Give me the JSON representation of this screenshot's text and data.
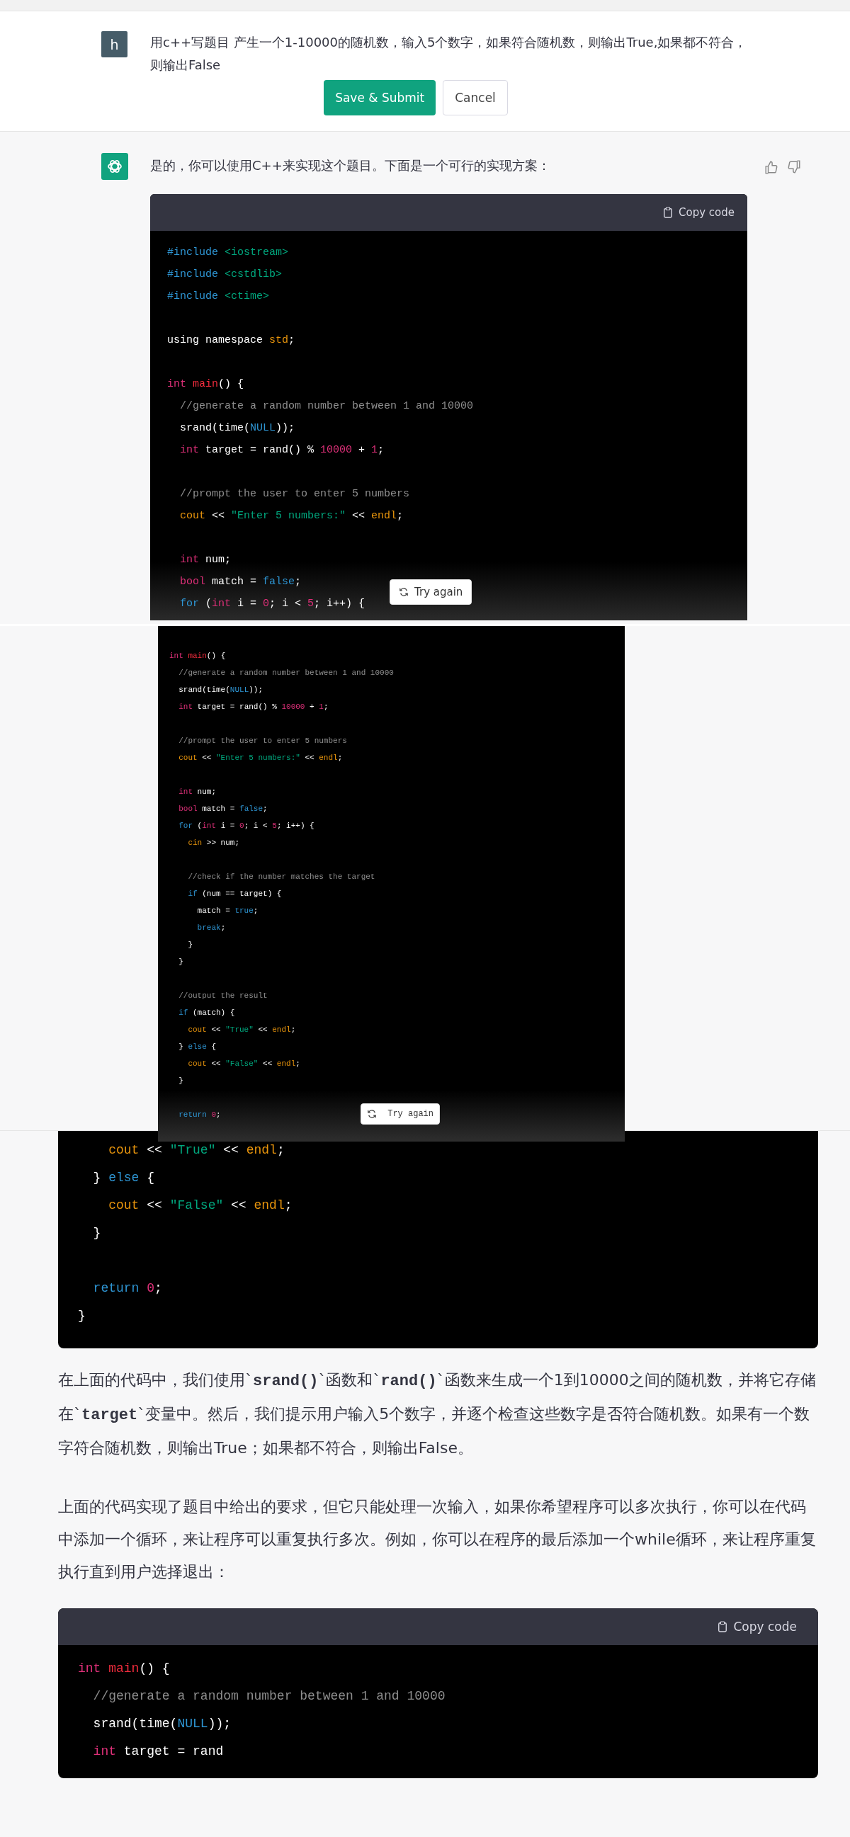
{
  "edit_view": {
    "user_message": {
      "avatar": "h",
      "text": "用c++写题目 产生一个1-10000的随机数，输入5个数字，如果符合随机数，则输出True,如果都不符合，则输出False"
    },
    "buttons": [
      {
        "label": "Save & Submit",
        "kind": "primary"
      },
      {
        "label": "Cancel",
        "kind": "secondary"
      }
    ],
    "assistant": {
      "intro": "是的，你可以使用C++来实现这个题目。下面是一个可行的实现方案：",
      "code_block": {
        "copy_label": "Copy code",
        "lines": [
          {
            "segments": [
              {
                "t": "#include",
                "kind": "meta"
              },
              {
                "t": " <iostream>",
                "kind": "meta_string"
              }
            ]
          },
          {
            "segments": [
              {
                "t": "#include",
                "kind": "meta"
              },
              {
                "t": " <cstdlib>",
                "kind": "meta_string"
              }
            ]
          },
          {
            "segments": [
              {
                "t": "#include",
                "kind": "meta"
              },
              {
                "t": " <ctime>",
                "kind": "meta_string"
              }
            ]
          },
          {
            "gap_before": true,
            "segments": [
              {
                "t": "using namespace"
              },
              {
                "t": " std",
                "kind": "builtin"
              },
              {
                "t": ";"
              }
            ]
          },
          {
            "gap_before": true,
            "segments": [
              {
                "t": "int",
                "kind": "type"
              },
              {
                "t": " main",
                "kind": "title"
              },
              {
                "t": "() {"
              }
            ]
          },
          {
            "segments": [
              {
                "t": "  //generate a random number between 1 and 10000",
                "kind": "comment"
              }
            ]
          },
          {
            "segments": [
              {
                "t": "  srand(time("
              },
              {
                "t": "NULL",
                "kind": "keyword"
              },
              {
                "t": "));"
              }
            ]
          },
          {
            "segments": [
              {
                "t": "  int",
                "kind": "type"
              },
              {
                "t": " target = rand() % "
              },
              {
                "t": "10000",
                "kind": "number"
              },
              {
                "t": " + "
              },
              {
                "t": "1",
                "kind": "number"
              },
              {
                "t": ";"
              }
            ]
          },
          {
            "gap_before": true,
            "segments": [
              {
                "t": "  //prompt the user to enter 5 numbers",
                "kind": "comment"
              }
            ]
          },
          {
            "segments": [
              {
                "t": "  cout",
                "kind": "builtin"
              },
              {
                "t": " << "
              },
              {
                "t": "\"Enter 5 numbers:\"",
                "kind": "string"
              },
              {
                "t": " << "
              },
              {
                "t": "endl",
                "kind": "builtin"
              },
              {
                "t": ";"
              }
            ]
          },
          {
            "gap_before": true,
            "segments": [
              {
                "t": "  int",
                "kind": "type"
              },
              {
                "t": " num;"
              }
            ]
          },
          {
            "segments": [
              {
                "t": "  bool",
                "kind": "type"
              },
              {
                "t": " match = "
              },
              {
                "t": "false",
                "kind": "keyword"
              },
              {
                "t": ";"
              }
            ]
          },
          {
            "segments": [
              {
                "t": "  for",
                "kind": "keyword"
              },
              {
                "t": " ("
              },
              {
                "t": "int",
                "kind": "type"
              },
              {
                "t": " i = "
              },
              {
                "t": "0",
                "kind": "number"
              },
              {
                "t": "; i < "
              },
              {
                "t": "5",
                "kind": "number"
              },
              {
                "t": "; i++) {"
              }
            ]
          }
        ]
      },
      "try_again": "Try again"
    }
  },
  "code_snapshot": {
    "lines": [
      {
        "segments": [
          {
            "t": "int",
            "kind": "type"
          },
          {
            "t": " main",
            "kind": "title"
          },
          {
            "t": "() {"
          }
        ]
      },
      {
        "segments": [
          {
            "t": "  //generate a random number between 1 and 10000",
            "kind": "comment"
          }
        ]
      },
      {
        "segments": [
          {
            "t": "  srand(time("
          },
          {
            "t": "NULL",
            "kind": "keyword"
          },
          {
            "t": "));"
          }
        ]
      },
      {
        "segments": [
          {
            "t": "  int",
            "kind": "type"
          },
          {
            "t": " target = rand() % "
          },
          {
            "t": "10000",
            "kind": "number"
          },
          {
            "t": " + "
          },
          {
            "t": "1",
            "kind": "number"
          },
          {
            "t": ";"
          }
        ]
      },
      {
        "gap_before": true,
        "segments": [
          {
            "t": "  //prompt the user to enter 5 numbers",
            "kind": "comment"
          }
        ]
      },
      {
        "segments": [
          {
            "t": "  cout",
            "kind": "builtin"
          },
          {
            "t": " << "
          },
          {
            "t": "\"Enter 5 numbers:\"",
            "kind": "string"
          },
          {
            "t": " << "
          },
          {
            "t": "endl",
            "kind": "builtin"
          },
          {
            "t": ";"
          }
        ]
      },
      {
        "gap_before": true,
        "segments": [
          {
            "t": "  int",
            "kind": "type"
          },
          {
            "t": " num;"
          }
        ]
      },
      {
        "segments": [
          {
            "t": "  bool",
            "kind": "type"
          },
          {
            "t": " match = "
          },
          {
            "t": "false",
            "kind": "keyword"
          },
          {
            "t": ";"
          }
        ]
      },
      {
        "segments": [
          {
            "t": "  for",
            "kind": "keyword"
          },
          {
            "t": " ("
          },
          {
            "t": "int",
            "kind": "type"
          },
          {
            "t": " i = "
          },
          {
            "t": "0",
            "kind": "number"
          },
          {
            "t": "; i < "
          },
          {
            "t": "5",
            "kind": "number"
          },
          {
            "t": "; i++) {"
          }
        ]
      },
      {
        "segments": [
          {
            "t": "    cin",
            "kind": "builtin"
          },
          {
            "t": " >> num;"
          }
        ]
      },
      {
        "gap_before": true,
        "segments": [
          {
            "t": "    //check if the number matches the target",
            "kind": "comment"
          }
        ]
      },
      {
        "segments": [
          {
            "t": "    if",
            "kind": "keyword"
          },
          {
            "t": " (num == target) {"
          }
        ]
      },
      {
        "segments": [
          {
            "t": "      match = "
          },
          {
            "t": "true",
            "kind": "keyword"
          },
          {
            "t": ";"
          }
        ]
      },
      {
        "segments": [
          {
            "t": "      break",
            "kind": "keyword"
          },
          {
            "t": ";"
          }
        ]
      },
      {
        "segments": [
          {
            "t": "    }"
          }
        ]
      },
      {
        "segments": [
          {
            "t": "  }"
          }
        ]
      },
      {
        "gap_before": true,
        "segments": [
          {
            "t": "  //output the result",
            "kind": "comment"
          }
        ]
      },
      {
        "segments": [
          {
            "t": "  if",
            "kind": "keyword"
          },
          {
            "t": " (match) {"
          }
        ]
      },
      {
        "segments": [
          {
            "t": "    cout",
            "kind": "builtin"
          },
          {
            "t": " << "
          },
          {
            "t": "\"True\"",
            "kind": "string"
          },
          {
            "t": " << "
          },
          {
            "t": "endl",
            "kind": "builtin"
          },
          {
            "t": ";"
          }
        ]
      },
      {
        "segments": [
          {
            "t": "  }"
          },
          {
            "t": " else",
            "kind": "keyword"
          },
          {
            "t": " {"
          }
        ]
      },
      {
        "segments": [
          {
            "t": "    cout",
            "kind": "builtin"
          },
          {
            "t": " << "
          },
          {
            "t": "\"False\"",
            "kind": "string"
          },
          {
            "t": " << "
          },
          {
            "t": "endl",
            "kind": "builtin"
          },
          {
            "t": ";"
          }
        ]
      },
      {
        "segments": [
          {
            "t": "  }"
          }
        ]
      },
      {
        "gap_before": true,
        "segments": [
          {
            "t": "  return",
            "kind": "keyword"
          },
          {
            "t": " 0",
            "kind": "number"
          },
          {
            "t": ";"
          }
        ]
      }
    ],
    "try_again": "Try again"
  },
  "answer_view": {
    "code_tail": [
      {
        "segments": [
          {
            "t": "    cout",
            "kind": "builtin"
          },
          {
            "t": " << "
          },
          {
            "t": "\"True\"",
            "kind": "string"
          },
          {
            "t": " << "
          },
          {
            "t": "endl",
            "kind": "builtin"
          },
          {
            "t": ";"
          }
        ]
      },
      {
        "segments": [
          {
            "t": "  }"
          },
          {
            "t": " else",
            "kind": "keyword"
          },
          {
            "t": " {"
          }
        ]
      },
      {
        "segments": [
          {
            "t": "    cout",
            "kind": "builtin"
          },
          {
            "t": " << "
          },
          {
            "t": "\"False\"",
            "kind": "string"
          },
          {
            "t": " << "
          },
          {
            "t": "endl",
            "kind": "builtin"
          },
          {
            "t": ";"
          }
        ]
      },
      {
        "segments": [
          {
            "t": "  }"
          }
        ]
      },
      {
        "gap_before": true,
        "segments": [
          {
            "t": "  return",
            "kind": "keyword"
          },
          {
            "t": " 0",
            "kind": "number"
          },
          {
            "t": ";"
          }
        ]
      },
      {
        "segments": [
          {
            "t": "}"
          }
        ]
      }
    ],
    "paragraphs": [
      "在上面的代码中，我们使用`**srand()**`函数和`**rand()**`函数来生成一个1到10000之间的随机数，并将它存储在`**target**`变量中。然后，我们提示用户输入5个数字，并逐个检查这些数字是否符合随机数。如果有一个数字符合随机数，则输出True；如果都不符合，则输出False。",
      "上面的代码实现了题目中给出的要求，但它只能处理一次输入，如果你希望程序可以多次执行，你可以在代码中添加一个循环，来让程序可以重复执行多次。例如，你可以在程序的最后添加一个while循环，来让程序重复执行直到用户选择退出："
    ],
    "code_block": {
      "copy_label": "Copy code",
      "lines": [
        {
          "segments": [
            {
              "t": "int",
              "kind": "type"
            },
            {
              "t": " main",
              "kind": "title"
            },
            {
              "t": "() {"
            }
          ]
        },
        {
          "segments": [
            {
              "t": "  //generate a random number between 1 and 10000",
              "kind": "comment"
            }
          ]
        },
        {
          "segments": [
            {
              "t": "  srand(time("
            },
            {
              "t": "NULL",
              "kind": "keyword"
            },
            {
              "t": "));"
            }
          ]
        },
        {
          "segments": [
            {
              "t": "  int",
              "kind": "type"
            },
            {
              "t": " target = rand"
            }
          ]
        }
      ]
    }
  }
}
